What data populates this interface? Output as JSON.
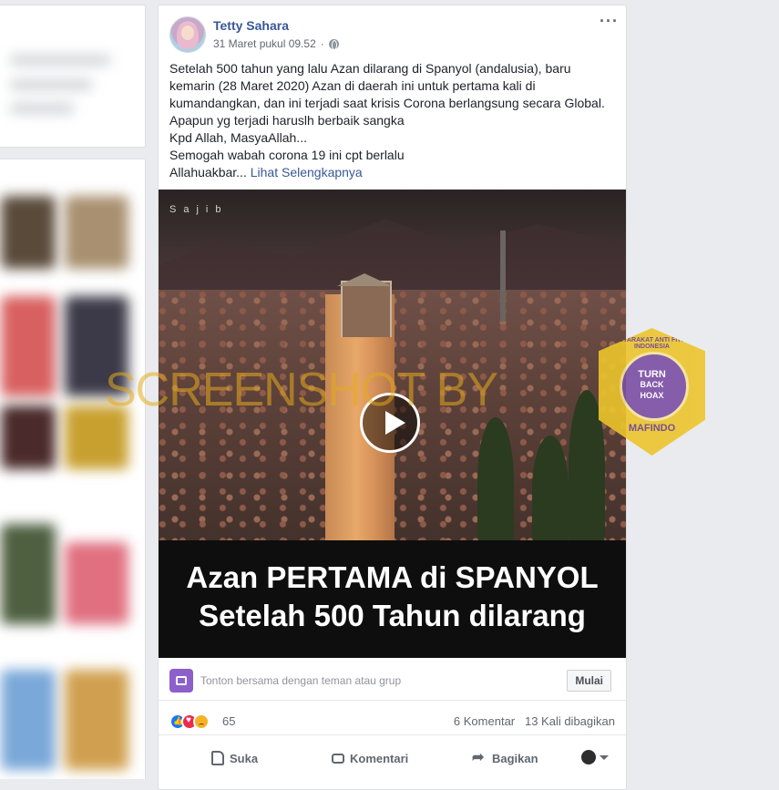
{
  "post": {
    "author": "Tetty Sahara",
    "timestamp": "31 Maret pukul 09.52",
    "text_lines": [
      "Setelah 500 tahun yang lalu Azan dilarang di Spanyol (andalusia), baru kemarin (28 Maret 2020) Azan di daerah ini untuk pertama kali di kumandangkan, dan ini terjadi saat krisis Corona berlangsung secara Global.",
      "Apapun yg terjadi haruslh berbaik sangka",
      "Kpd Allah, MasyaAllah...",
      "Semogah wabah corona 19 ini cpt berlalu",
      "Allahuakbar..."
    ],
    "see_more": "Lihat Selengkapnya"
  },
  "video": {
    "brand": "Sajib",
    "caption_line1": "Azan PERTAMA di SPANYOL",
    "caption_line2": "Setelah 500 Tahun dilarang"
  },
  "watermark": "SCREENSHOT BY",
  "badge": {
    "ring_text": "MASYARAKAT ANTI FITNAH INDONESIA",
    "line1": "TURN",
    "line2": "BACK",
    "line3": "HOAX",
    "bottom": "MAFINDO"
  },
  "watch_party": {
    "text": "Tonton bersama dengan teman atau grup",
    "button": "Mulai"
  },
  "reactions": {
    "count": "65",
    "comments": "6 Komentar",
    "shares": "13 Kali dibagikan",
    "types": [
      "like-icon",
      "love-icon",
      "sad-icon"
    ]
  },
  "actions": {
    "like": "Suka",
    "comment": "Komentari",
    "share": "Bagikan"
  },
  "colors": {
    "link": "#385898",
    "background": "#e9ebee",
    "watermark": "#e6aa1e",
    "badge": "#ecc52c"
  }
}
